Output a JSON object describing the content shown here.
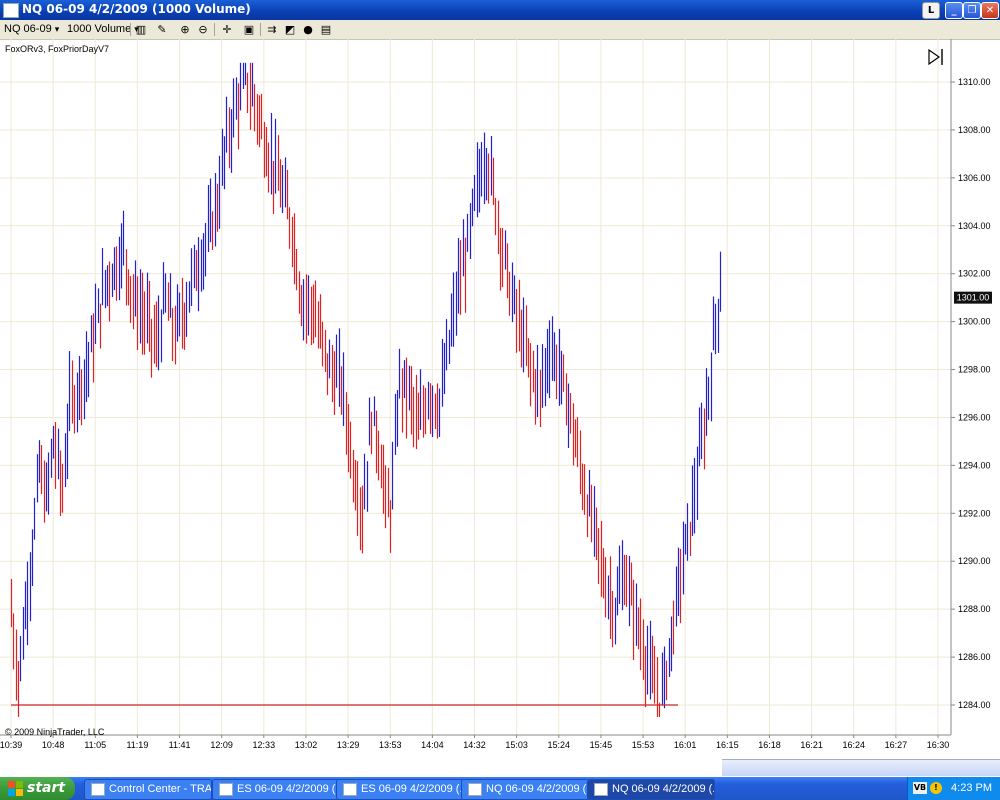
{
  "window": {
    "title": "NQ 06-09  4/2/2009 (1000 Volume)",
    "btn_l": "L",
    "btn_min": "_",
    "btn_max": "❐",
    "btn_close": "✕"
  },
  "toolbar": {
    "instrument": "NQ 06-09",
    "period": "1000 Volume"
  },
  "chart": {
    "indicators": "FoxORv3, FoxPriorDayV7",
    "copyright": "© 2009 NinjaTrader, LLC",
    "last_price": "1301.00",
    "ymin": 1283,
    "ymax": 1312,
    "y_ticks": [
      "1284.00",
      "1286.00",
      "1288.00",
      "1290.00",
      "1292.00",
      "1294.00",
      "1296.00",
      "1298.00",
      "1300.00",
      "1302.00",
      "1304.00",
      "1306.00",
      "1308.00",
      "1310.00"
    ],
    "x_ticks": [
      "10:39",
      "10:48",
      "11:05",
      "11:19",
      "11:41",
      "12:09",
      "12:33",
      "13:02",
      "13:29",
      "13:53",
      "14:04",
      "14:32",
      "15:03",
      "15:24",
      "15:45",
      "15:53",
      "16:01",
      "16:15",
      "16:18",
      "16:21",
      "16:24",
      "16:27",
      "16:30"
    ],
    "prior_day_line": 1284.0,
    "colors": {
      "up": "#2222cc",
      "down": "#dd2222",
      "level": "#cc2222",
      "grid": "#efe9d6"
    }
  },
  "chart_data": {
    "type": "bar",
    "title": "",
    "bar_count": 231,
    "price_path": [
      [
        0,
        1288.0
      ],
      [
        3,
        1285.0
      ],
      [
        5,
        1287.0
      ],
      [
        10,
        1291.5
      ],
      [
        12,
        1294.0
      ],
      [
        15,
        1292.5
      ],
      [
        18,
        1295.0
      ],
      [
        22,
        1293.0
      ],
      [
        25,
        1296.5
      ],
      [
        32,
        1298.0
      ],
      [
        40,
        1301.5
      ],
      [
        48,
        1303.0
      ],
      [
        52,
        1301.0
      ],
      [
        58,
        1300.0
      ],
      [
        62,
        1299.0
      ],
      [
        66,
        1301.0
      ],
      [
        70,
        1299.5
      ],
      [
        74,
        1300.5
      ],
      [
        78,
        1302.0
      ],
      [
        84,
        1303.5
      ],
      [
        88,
        1305.0
      ],
      [
        92,
        1307.5
      ],
      [
        96,
        1309.0
      ],
      [
        100,
        1310.3
      ],
      [
        103,
        1309.5
      ],
      [
        106,
        1308.5
      ],
      [
        110,
        1307.0
      ],
      [
        114,
        1306.0
      ],
      [
        120,
        1304.0
      ],
      [
        124,
        1301.0
      ],
      [
        129,
        1300.5
      ],
      [
        133,
        1299.0
      ],
      [
        136,
        1298.0
      ],
      [
        141,
        1297.5
      ],
      [
        146,
        1294.0
      ],
      [
        150,
        1292.0
      ],
      [
        154,
        1296.0
      ],
      [
        157,
        1295.0
      ],
      [
        160,
        1292.5
      ],
      [
        162,
        1292.0
      ],
      [
        166,
        1297.5
      ],
      [
        170,
        1297.0
      ],
      [
        174,
        1295.5
      ],
      [
        178,
        1297.0
      ],
      [
        183,
        1296.5
      ],
      [
        187,
        1299.0
      ],
      [
        191,
        1301.5
      ],
      [
        195,
        1303.0
      ],
      [
        198,
        1305.0
      ],
      [
        201,
        1306.5
      ],
      [
        203,
        1307.0
      ],
      [
        206,
        1305.5
      ],
      [
        210,
        1303.0
      ],
      [
        214,
        1301.0
      ],
      [
        218,
        1299.5
      ],
      [
        222,
        1298.0
      ],
      [
        226,
        1297.0
      ],
      [
        230,
        1299.0
      ],
      [
        234,
        1298.0
      ],
      [
        238,
        1296.5
      ],
      [
        242,
        1294.5
      ],
      [
        246,
        1292.5
      ],
      [
        250,
        1291.0
      ],
      [
        254,
        1289.0
      ],
      [
        258,
        1288.0
      ],
      [
        262,
        1289.5
      ],
      [
        266,
        1288.0
      ],
      [
        270,
        1286.5
      ],
      [
        274,
        1285.0
      ],
      [
        277,
        1284.0
      ],
      [
        280,
        1285.5
      ],
      [
        283,
        1287.5
      ],
      [
        286,
        1289.5
      ],
      [
        290,
        1291.5
      ],
      [
        293,
        1293.5
      ],
      [
        296,
        1295.5
      ],
      [
        299,
        1298.0
      ],
      [
        301,
        1300.0
      ],
      [
        303,
        1301.5
      ]
    ],
    "price_range": [
      1283.5,
      1310.8
    ],
    "ylim": [
      1283,
      1312
    ],
    "last": 1301.0,
    "level": 1284.0
  }
}
